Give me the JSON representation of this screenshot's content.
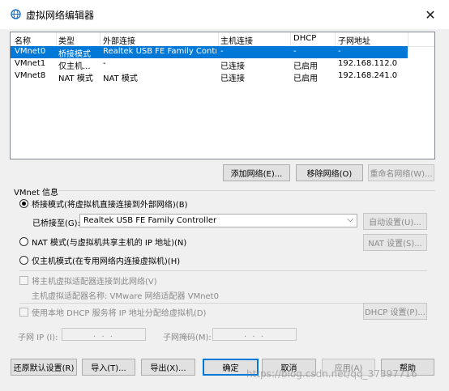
{
  "window": {
    "title": "虚拟网络编辑器",
    "close_glyph": "✕"
  },
  "table": {
    "columns": [
      "名称",
      "类型",
      "外部连接",
      "主机连接",
      "DHCP",
      "子网地址"
    ],
    "rows": [
      [
        "VMnet0",
        "桥接模式",
        "Realtek USB FE Family Contro...",
        "-",
        "-",
        "-"
      ],
      [
        "VMnet1",
        "仅主机...",
        "-",
        "已连接",
        "已启用",
        "192.168.112.0"
      ],
      [
        "VMnet8",
        "NAT 模式",
        "NAT 模式",
        "已连接",
        "已启用",
        "192.168.241.0"
      ]
    ],
    "selected_index": 0
  },
  "network_buttons": {
    "add": "添加网络(E)...",
    "remove": "移除网络(O)",
    "rename": "重命名网络(W)..."
  },
  "vmnet_info": {
    "group_label": "VMnet 信息",
    "bridged_label": "桥接模式(将虚拟机直接连接到外部网络)(B)",
    "bridged_to_label": "已桥接至(G):",
    "bridged_to_value": "Realtek USB FE Family Controller",
    "auto_settings": "自动设置(U)...",
    "nat_label": "NAT 模式(与虚拟机共享主机的 IP 地址)(N)",
    "nat_settings": "NAT 设置(S)...",
    "hostonly_label": "仅主机模式(在专用网络内连接虚拟机)(H)",
    "connect_adapter_label": "将主机虚拟适配器连接到此网络(V)",
    "adapter_name_label": "主机虚拟适配器名称: VMware 网络适配器 VMnet0",
    "dhcp_label": "使用本地 DHCP 服务将 IP 地址分配给虚拟机(D)",
    "dhcp_settings": "DHCP 设置(P)...",
    "subnet_ip_label": "子网 IP (I):",
    "subnet_ip_value": ". . .",
    "subnet_mask_label": "子网掩码(M):",
    "subnet_mask_value": ". . ."
  },
  "footer": {
    "restore": "还原默认设置(R)",
    "import": "导入(T)...",
    "export": "导出(X)...",
    "ok": "确定",
    "cancel": "取消",
    "apply": "应用(A)",
    "help": "帮助"
  },
  "watermark": "https://blog.csdn.net/qq_37397716",
  "colors": {
    "selection": "#0078d7",
    "dialog_bg": "#f0f0f0"
  }
}
